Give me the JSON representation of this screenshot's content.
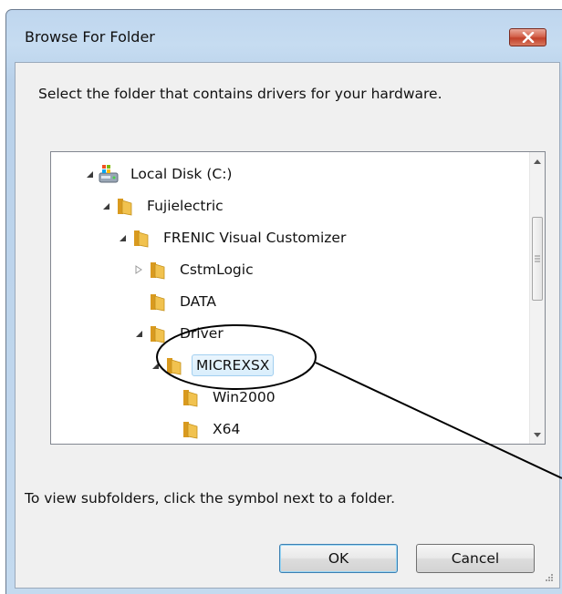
{
  "window": {
    "title": "Browse For Folder"
  },
  "dialog": {
    "instructions": "Select the folder that contains drivers for your hardware.",
    "hint": "To view subfolders, click the symbol next to a folder."
  },
  "tree": {
    "items": [
      {
        "label": "Local Disk (C:)",
        "icon": "local-disk-icon",
        "expander": "expanded"
      },
      {
        "label": "Fujielectric",
        "icon": "folder-icon",
        "expander": "expanded"
      },
      {
        "label": "FRENIC Visual Customizer",
        "icon": "folder-icon",
        "expander": "expanded"
      },
      {
        "label": "CstmLogic",
        "icon": "folder-icon",
        "expander": "collapsed"
      },
      {
        "label": "DATA",
        "icon": "folder-icon",
        "expander": "none"
      },
      {
        "label": "Driver",
        "icon": "folder-icon",
        "expander": "expanded"
      },
      {
        "label": "MICREXSX",
        "icon": "folder-icon",
        "expander": "expanded",
        "selected": true
      },
      {
        "label": "Win2000",
        "icon": "folder-icon",
        "expander": "none"
      },
      {
        "label": "X64",
        "icon": "folder-icon",
        "expander": "none"
      }
    ]
  },
  "buttons": {
    "ok": "OK",
    "cancel": "Cancel"
  },
  "colors": {
    "title_bg": "#c4daef",
    "client_bg": "#f0f0f0",
    "close_button": "#c2412a",
    "selection_bg": "#d9eefc",
    "selection_border": "#a2cff0",
    "folder": "#e7b53a"
  },
  "icons": {
    "close": "close-icon",
    "scroll_up": "scroll-up-arrow-icon",
    "scroll_down": "scroll-down-arrow-icon",
    "grip": "resize-grip-icon"
  }
}
